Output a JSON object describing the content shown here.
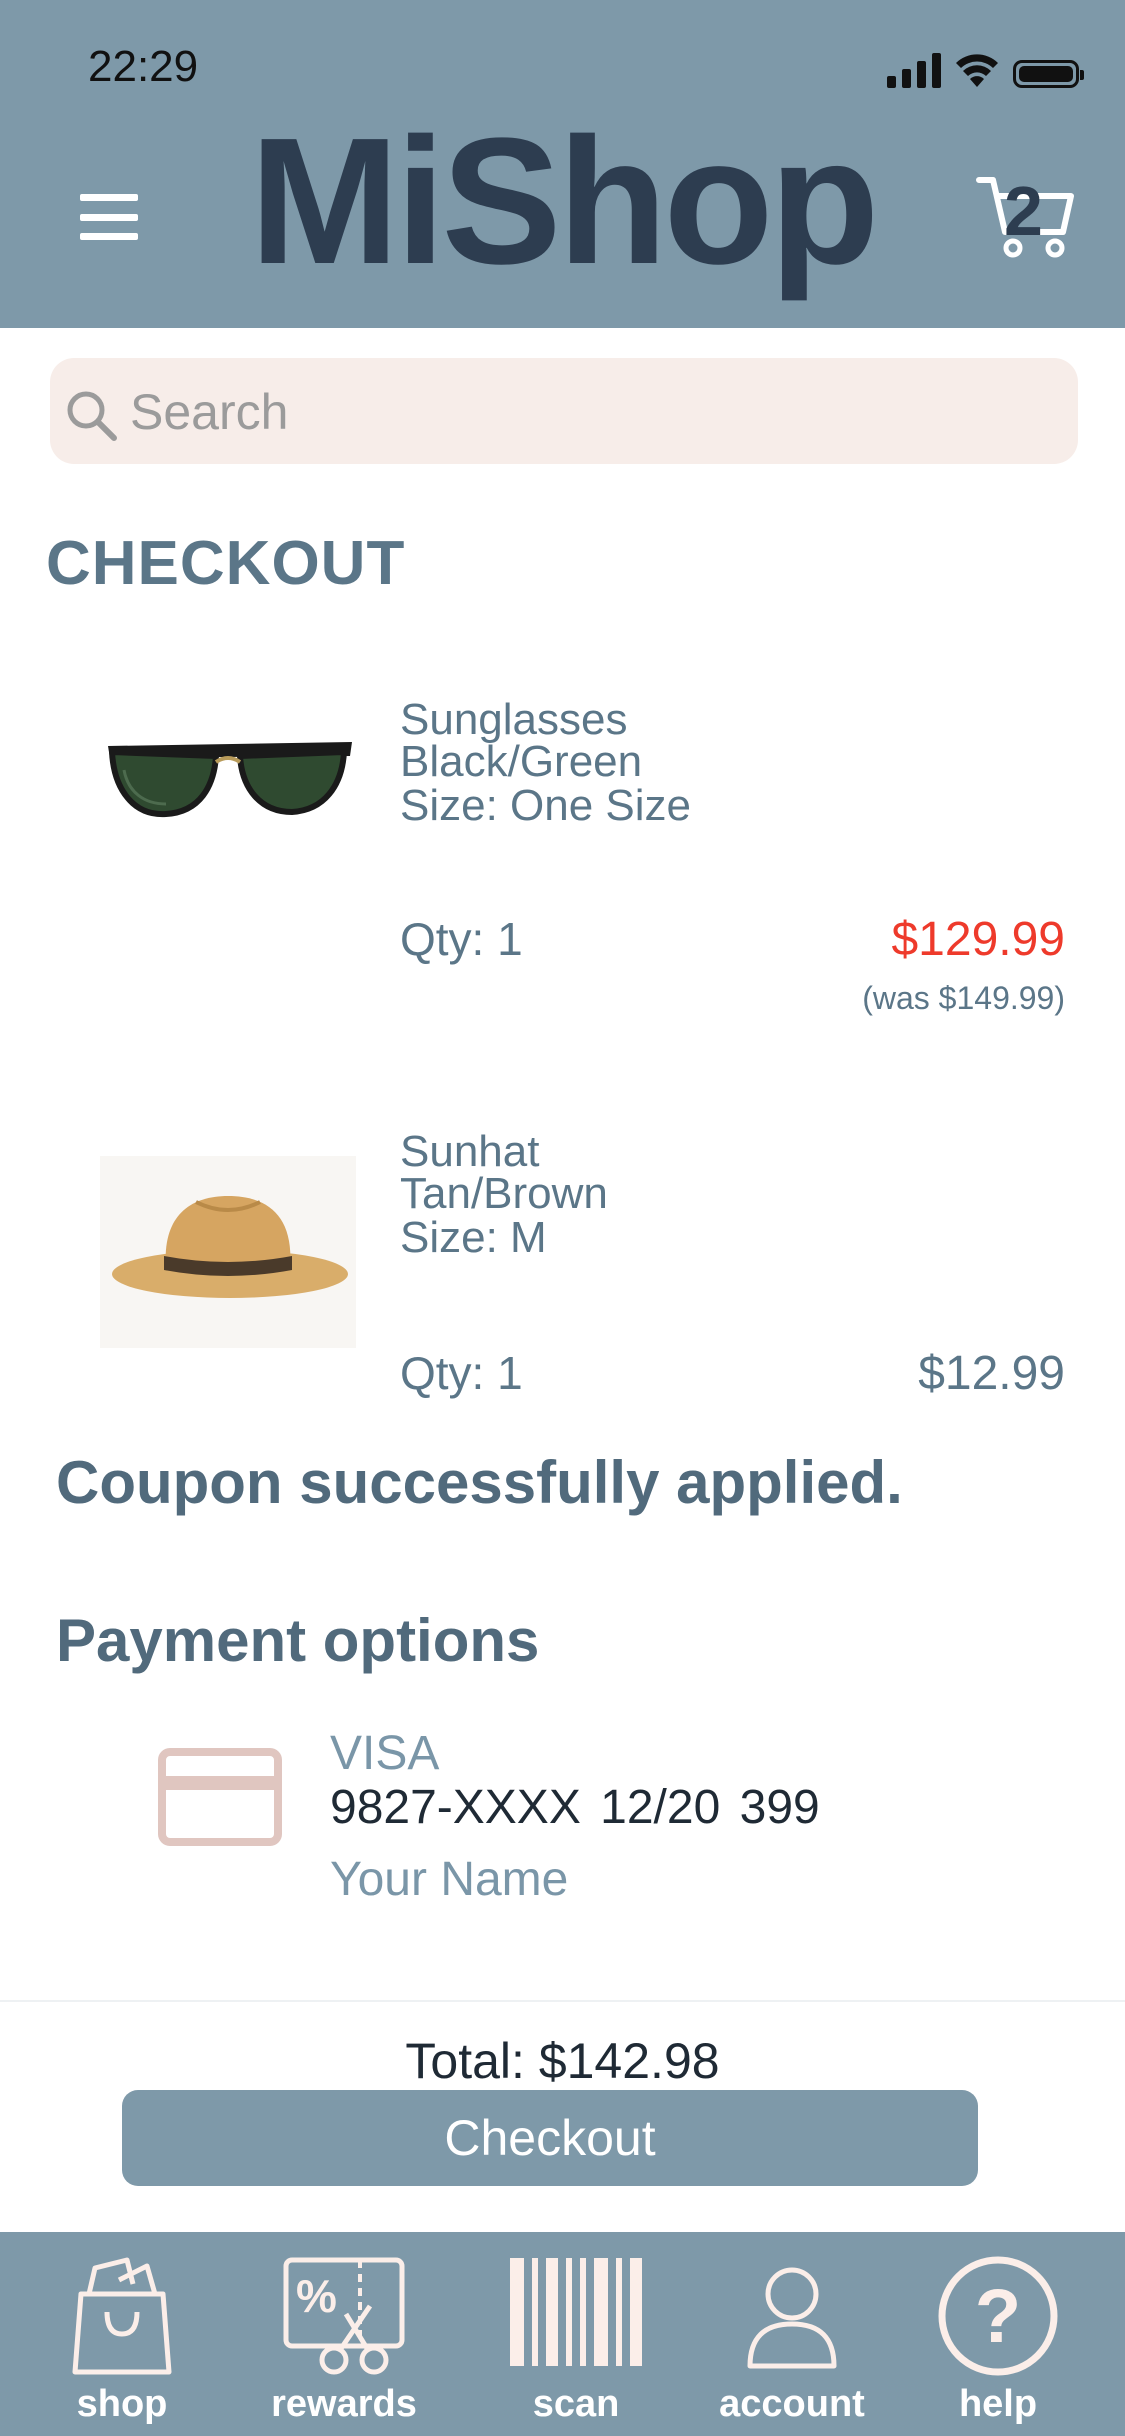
{
  "status": {
    "time": "22:29"
  },
  "header": {
    "logo": "MiShop",
    "cart_count": "2"
  },
  "search": {
    "placeholder": "Search"
  },
  "page": {
    "title": "CHECKOUT"
  },
  "items": [
    {
      "name": "Sunglasses",
      "color": "Black/Green",
      "size": "Size: One Size",
      "qty": "Qty: 1",
      "price": "$129.99",
      "was": "(was $149.99)"
    },
    {
      "name": "Sunhat",
      "color": "Tan/Brown",
      "size": "Size: M",
      "qty": "Qty: 1",
      "price": "$12.99"
    }
  ],
  "coupon": {
    "message": "Coupon successfully applied."
  },
  "payment": {
    "title": "Payment options",
    "brand": "VISA",
    "number": "9827-XXXX 12/20 399",
    "name": "Your Name"
  },
  "summary": {
    "total": "Total: $142.98",
    "checkout_label": "Checkout"
  },
  "nav": {
    "items": [
      {
        "label": "shop",
        "icon": "shopping-bag-icon"
      },
      {
        "label": "rewards",
        "icon": "rewards-coupon-icon"
      },
      {
        "label": "scan",
        "icon": "barcode-icon"
      },
      {
        "label": "account",
        "icon": "user-icon"
      },
      {
        "label": "help",
        "icon": "help-icon"
      }
    ]
  },
  "colors": {
    "header_bg": "#7e99a9",
    "logo": "#2d3d50",
    "text": "#5b7688",
    "sale_price": "#ee3a2b",
    "search_bg": "#f7ede9",
    "card_icon": "#e0c6c0"
  }
}
